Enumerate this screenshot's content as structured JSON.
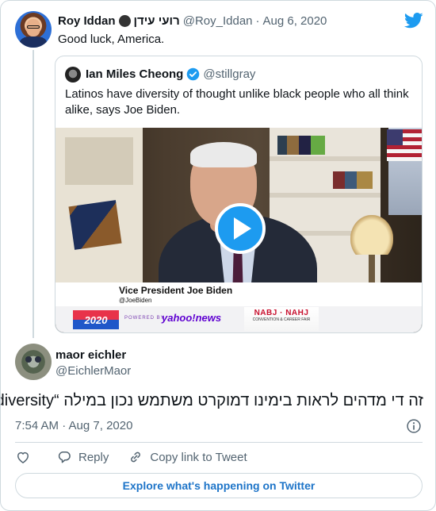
{
  "colors": {
    "accent": "#1d9bf0",
    "text_primary": "#0f1419",
    "text_secondary": "#536471",
    "border": "#cfd9de",
    "link": "#1d74c8"
  },
  "icons": {
    "brand": "twitter-bird-icon",
    "verified": "verified-badge-icon",
    "play": "play-icon",
    "info": "info-icon",
    "like": "heart-icon",
    "reply": "reply-bubble-icon",
    "copy_link": "link-icon"
  },
  "main_tweet": {
    "display_name": "Roy Iddan",
    "hebrew_name": "רועי עידן",
    "handle": "@Roy_Iddan",
    "separator": "·",
    "date": "Aug 6, 2020",
    "text": "Good luck, America."
  },
  "quoted_tweet": {
    "display_name": "Ian Miles Cheong",
    "handle": "@stillgray",
    "text": "Latinos have diversity of thought unlike black people who all think alike, says Joe Biden.",
    "video": {
      "lower_third_name": "Vice President Joe Biden",
      "lower_third_handle": "@JoeBiden",
      "badge": "2020",
      "powered_by": "POWERED BY",
      "brand": "yahoo!news",
      "sponsor": "NABJ · NAHJ",
      "sponsor_sub": "CONVENTION & CAREER FAIR"
    }
  },
  "reply_tweet": {
    "display_name": "maor eichler",
    "handle": "@EichlerMaor",
    "text": "זה די מדהים לראות בימינו דמוקרט משתמש נכון במילה “diversity”",
    "timestamp": "7:54 AM · Aug 7, 2020"
  },
  "actions": {
    "reply_label": "Reply",
    "copy_link_label": "Copy link to Tweet"
  },
  "footer": {
    "explore_label": "Explore what's happening on Twitter"
  }
}
